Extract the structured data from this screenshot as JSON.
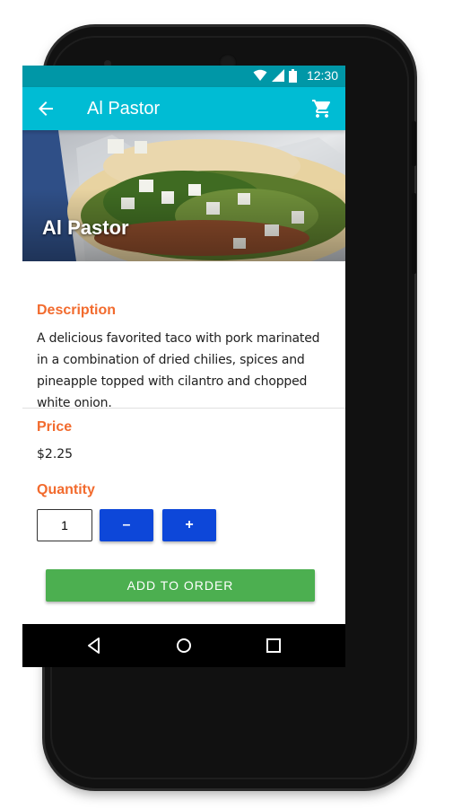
{
  "status_bar": {
    "time": "12:30",
    "icons": [
      "wifi-icon",
      "signal-icon",
      "battery-icon"
    ]
  },
  "app_bar": {
    "title": "Al Pastor",
    "back_icon": "arrow-back-icon",
    "cart_icon": "shopping-cart-icon"
  },
  "hero": {
    "title": "Al Pastor"
  },
  "description": {
    "heading": "Description",
    "text": "A delicious favorited taco with pork marinated in a combination of dried chilies, spices and pineapple topped with cilantro and chopped white onion."
  },
  "price": {
    "heading": "Price",
    "value": "$2.25"
  },
  "quantity": {
    "heading": "Quantity",
    "value": "1",
    "decrement_label": "–",
    "increment_label": "+"
  },
  "actions": {
    "add_to_order_label": "ADD TO ORDER"
  },
  "nav_bar": {
    "icons": [
      "back-triangle-icon",
      "home-circle-icon",
      "recents-square-icon"
    ]
  },
  "colors": {
    "status_bar": "#0097a7",
    "app_bar": "#00bcd4",
    "heading_accent": "#f26b2e",
    "qty_button": "#0d47d9",
    "add_button": "#4caf50"
  }
}
